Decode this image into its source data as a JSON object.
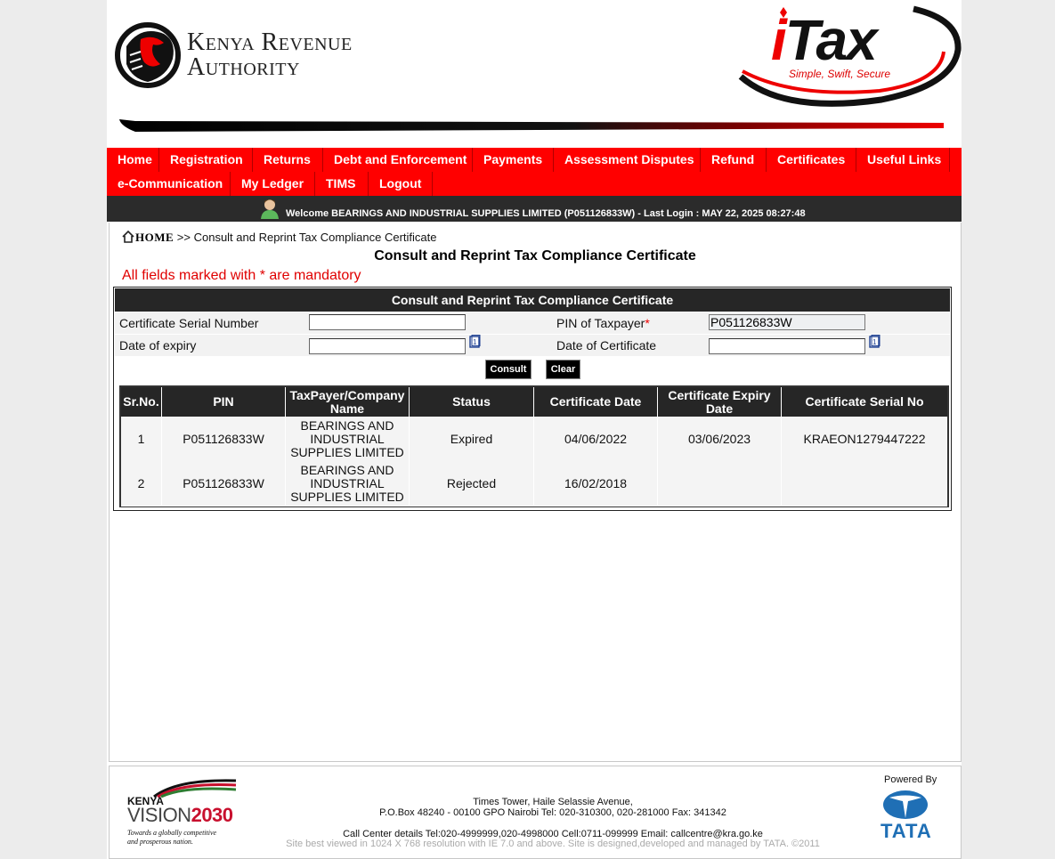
{
  "header": {
    "kra_line1": "Kenya Revenue",
    "kra_line2": "Authority",
    "itax_word": "Tax",
    "itax_prefix": "i",
    "itax_tagline": "Simple, Swift, Secure"
  },
  "nav": {
    "row1": [
      "Home",
      "Registration",
      "Returns",
      "Debt and Enforcement",
      "Payments",
      "Assessment Disputes",
      "Refund",
      "Certificates",
      "Useful Links"
    ],
    "row2": [
      "e-Communication",
      "My Ledger",
      "TIMS",
      "Logout"
    ]
  },
  "welcome": {
    "text": "Welcome BEARINGS AND INDUSTRIAL SUPPLIES LIMITED (P051126833W)  - Last Login : MAY 22, 2025 08:27:48"
  },
  "breadcrumb": {
    "home": "HOME",
    "current": ">> Consult and Reprint Tax Compliance Certificate"
  },
  "page": {
    "title": "Consult and Reprint Tax Compliance Certificate",
    "mandatory_note": "All fields marked with * are mandatory"
  },
  "form": {
    "heading": "Consult and Reprint Tax Compliance Certificate",
    "serial_label": "Certificate Serial Number",
    "serial_value": "",
    "pin_label": "PIN of Taxpayer",
    "pin_required_mark": "*",
    "pin_value": "P051126833W",
    "expiry_label": "Date of expiry",
    "expiry_value": "",
    "cert_date_label": "Date of Certificate",
    "cert_date_value": "",
    "consult_label": "Consult",
    "clear_label": "Clear"
  },
  "results": {
    "headers": [
      "Sr.No.",
      "PIN",
      "TaxPayer/Company Name",
      "Status",
      "Certificate Date",
      "Certificate Expiry Date",
      "Certificate Serial No"
    ],
    "rows": [
      {
        "sr": "1",
        "pin": "P051126833W",
        "name": "BEARINGS AND INDUSTRIAL SUPPLIES LIMITED",
        "status": "Expired",
        "cert_date": "04/06/2022",
        "expiry_date": "03/06/2023",
        "serial": "KRAEON1279447222"
      },
      {
        "sr": "2",
        "pin": "P051126833W",
        "name": "BEARINGS AND INDUSTRIAL SUPPLIES LIMITED",
        "status": "Rejected",
        "cert_date": "16/02/2018",
        "expiry_date": "",
        "serial": ""
      }
    ]
  },
  "footer": {
    "vision_kenya": "KENYA",
    "vision_word": "VISION",
    "vision_year": "2030",
    "vision_tagline_1": "Towards a globally competitive",
    "vision_tagline_2": "and prosperous nation.",
    "address_1": "Times Tower, Haile Selassie Avenue,",
    "address_2": "P.O.Box 48240 - 00100 GPO Nairobi Tel: 020-310300, 020-281000 Fax: 341342",
    "call_center": "Call Center details Tel:020-4999999,020-4998000 Cell:0711-099999 Email: callcentre@kra.go.ke",
    "site_note": "Site best viewed in 1024 X 768 resolution with IE 7.0 and above. Site is designed,developed and managed by TATA. ©2011",
    "powered_by": "Powered By",
    "tata": "TATA"
  },
  "colors": {
    "nav_red": "#ff0000",
    "dark_bar": "#262626",
    "mandatory_red": "#e00000",
    "tata_blue": "#1f6fb5"
  }
}
